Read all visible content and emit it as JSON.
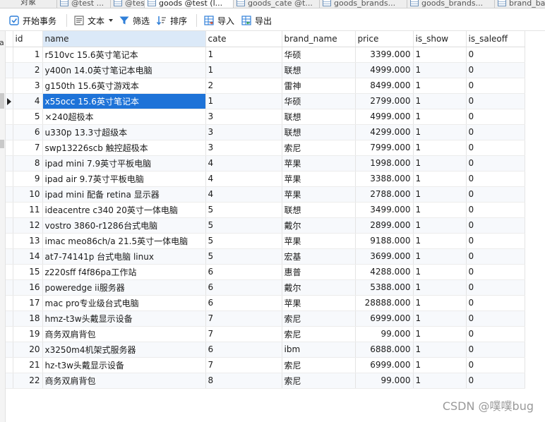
{
  "tabs": [
    {
      "label": "对象"
    },
    {
      "label": "@test ..."
    },
    {
      "label": "@test ..."
    },
    {
      "label": "goods @test (l..."
    },
    {
      "label": "goods_cate @t..."
    },
    {
      "label": "goods_brands..."
    },
    {
      "label": "goods_brands..."
    },
    {
      "label": "brand_ba"
    }
  ],
  "toolbar": {
    "begin_transaction": "开始事务",
    "text": "文本",
    "filter": "筛选",
    "sort": "排序",
    "import": "导入",
    "export": "导出"
  },
  "left_fragment": "a",
  "columns": [
    "id",
    "name",
    "cate",
    "brand_name",
    "price",
    "is_show",
    "is_saleoff"
  ],
  "rows": [
    {
      "id": "1",
      "name": "r510vc 15.6英寸笔记本",
      "cate": "1",
      "brand_name": "华硕",
      "price": "3399.000",
      "is_show": "1",
      "is_saleoff": "0"
    },
    {
      "id": "2",
      "name": "y400n 14.0英寸笔记本电脑",
      "cate": "1",
      "brand_name": "联想",
      "price": "4999.000",
      "is_show": "1",
      "is_saleoff": "0"
    },
    {
      "id": "3",
      "name": "g150th 15.6英寸游戏本",
      "cate": "2",
      "brand_name": "雷神",
      "price": "8499.000",
      "is_show": "1",
      "is_saleoff": "0"
    },
    {
      "id": "4",
      "name": "x55occ 15.6英寸笔记本",
      "cate": "1",
      "brand_name": "华硕",
      "price": "2799.000",
      "is_show": "1",
      "is_saleoff": "0"
    },
    {
      "id": "5",
      "name": "×240超极本",
      "cate": "3",
      "brand_name": "联想",
      "price": "4999.000",
      "is_show": "1",
      "is_saleoff": "0"
    },
    {
      "id": "6",
      "name": "u330p 13.3寸超级本",
      "cate": "3",
      "brand_name": "联想",
      "price": "4299.000",
      "is_show": "1",
      "is_saleoff": "0"
    },
    {
      "id": "7",
      "name": "swp13226scb 触控超极本",
      "cate": "3",
      "brand_name": "索尼",
      "price": "7999.000",
      "is_show": "1",
      "is_saleoff": "0"
    },
    {
      "id": "8",
      "name": "ipad mini 7.9英寸平板电脑",
      "cate": "4",
      "brand_name": "苹果",
      "price": "1998.000",
      "is_show": "1",
      "is_saleoff": "0"
    },
    {
      "id": "9",
      "name": "ipad air 9.7英寸平板电脑",
      "cate": "4",
      "brand_name": "苹果",
      "price": "3388.000",
      "is_show": "1",
      "is_saleoff": "0"
    },
    {
      "id": "10",
      "name": "ipad mini 配备 retina 显示器",
      "cate": "4",
      "brand_name": "苹果",
      "price": "2788.000",
      "is_show": "1",
      "is_saleoff": "0"
    },
    {
      "id": "11",
      "name": "ideacentre c340 20英寸一体电脑",
      "cate": "5",
      "brand_name": "联想",
      "price": "3499.000",
      "is_show": "1",
      "is_saleoff": "0"
    },
    {
      "id": "12",
      "name": "vostro 3860-r1286台式电脑",
      "cate": "5",
      "brand_name": "戴尔",
      "price": "2899.000",
      "is_show": "1",
      "is_saleoff": "0"
    },
    {
      "id": "13",
      "name": "imac meo86ch/a 21.5英寸一体电脑",
      "cate": "5",
      "brand_name": "苹果",
      "price": "9188.000",
      "is_show": "1",
      "is_saleoff": "0"
    },
    {
      "id": "14",
      "name": "at7-74141p 台式电脑 linux",
      "cate": "5",
      "brand_name": "宏基",
      "price": "3699.000",
      "is_show": "1",
      "is_saleoff": "0"
    },
    {
      "id": "15",
      "name": "z220sff f4f86pa工作站",
      "cate": "6",
      "brand_name": "惠普",
      "price": "4288.000",
      "is_show": "1",
      "is_saleoff": "0"
    },
    {
      "id": "16",
      "name": "poweredge ii服务器",
      "cate": "6",
      "brand_name": "戴尔",
      "price": "5388.000",
      "is_show": "1",
      "is_saleoff": "0"
    },
    {
      "id": "17",
      "name": "mac pro专业级台式电脑",
      "cate": "6",
      "brand_name": "苹果",
      "price": "28888.000",
      "is_show": "1",
      "is_saleoff": "0"
    },
    {
      "id": "18",
      "name": "hmz-t3w头戴显示设备",
      "cate": "7",
      "brand_name": "索尼",
      "price": "6999.000",
      "is_show": "1",
      "is_saleoff": "0"
    },
    {
      "id": "19",
      "name": "商务双肩背包",
      "cate": "7",
      "brand_name": "索尼",
      "price": "99.000",
      "is_show": "1",
      "is_saleoff": "0"
    },
    {
      "id": "20",
      "name": "x3250m4机架式服务器",
      "cate": "6",
      "brand_name": " ibm",
      "price": "6888.000",
      "is_show": "1",
      "is_saleoff": "0"
    },
    {
      "id": "21",
      "name": "hz-t3w头戴显示设备",
      "cate": "7",
      "brand_name": "索尼",
      "price": "6999.000",
      "is_show": "1",
      "is_saleoff": "0"
    },
    {
      "id": "22",
      "name": "商务双肩背包",
      "cate": "8",
      "brand_name": "索尼",
      "price": "99.000",
      "is_show": "1",
      "is_saleoff": "0"
    }
  ],
  "selected_row_id": "4",
  "watermark": "CSDN @噗噗bug",
  "colors": {
    "selection": "#1e73d8",
    "header_selected": "#dbe9f8",
    "toolbar_icon": "#2f7fd8"
  }
}
